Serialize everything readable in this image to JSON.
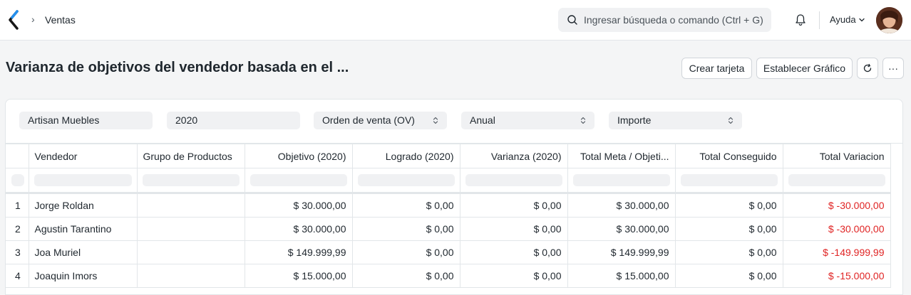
{
  "navbar": {
    "breadcrumb_sep": "›",
    "breadcrumb": "Ventas",
    "search_placeholder": "Ingresar búsqueda o comando (Ctrl + G)",
    "help_label": "Ayuda",
    "logo_icon": "frappe-logo-icon",
    "colors": {
      "logo": "#2490ef"
    }
  },
  "page": {
    "title": "Varianza de objetivos del vendedor basada en el ...",
    "buttons": {
      "create_card": "Crear tarjeta",
      "set_chart": "Establecer Gráfico",
      "refresh_icon": "refresh-icon",
      "more": "···"
    }
  },
  "filters": [
    {
      "value": "Artisan Muebles",
      "select": false
    },
    {
      "value": "2020",
      "select": false
    },
    {
      "value": "Orden de venta (OV)",
      "select": true
    },
    {
      "value": "Anual",
      "select": true
    },
    {
      "value": "Importe",
      "select": true
    }
  ],
  "table": {
    "columns": [
      "",
      "Vendedor",
      "Grupo de Productos",
      "Objetivo (2020)",
      "Logrado (2020)",
      "Varianza (2020)",
      "Total Meta / Objeti...",
      "Total Conseguido",
      "Total Variacion"
    ],
    "rows": [
      {
        "idx": "1",
        "vendedor": "Jorge Roldan",
        "grupo": "",
        "objetivo": "$ 30.000,00",
        "logrado": "$ 0,00",
        "varianza": "$ 0,00",
        "total_meta": "$ 30.000,00",
        "total_conseguido": "$ 0,00",
        "total_variacion": "$ -30.000,00"
      },
      {
        "idx": "2",
        "vendedor": "Agustin Tarantino",
        "grupo": "",
        "objetivo": "$ 30.000,00",
        "logrado": "$ 0,00",
        "varianza": "$ 0,00",
        "total_meta": "$ 30.000,00",
        "total_conseguido": "$ 0,00",
        "total_variacion": "$ -30.000,00"
      },
      {
        "idx": "3",
        "vendedor": "Joa Muriel",
        "grupo": "",
        "objetivo": "$ 149.999,99",
        "logrado": "$ 0,00",
        "varianza": "$ 0,00",
        "total_meta": "$ 149.999,99",
        "total_conseguido": "$ 0,00",
        "total_variacion": "$ -149.999,99"
      },
      {
        "idx": "4",
        "vendedor": "Joaquin Imors",
        "grupo": "",
        "objetivo": "$ 15.000,00",
        "logrado": "$ 0,00",
        "varianza": "$ 0,00",
        "total_meta": "$ 15.000,00",
        "total_conseguido": "$ 0,00",
        "total_variacion": "$ -15.000,00"
      }
    ],
    "colors": {
      "negative": "#e02424"
    }
  }
}
